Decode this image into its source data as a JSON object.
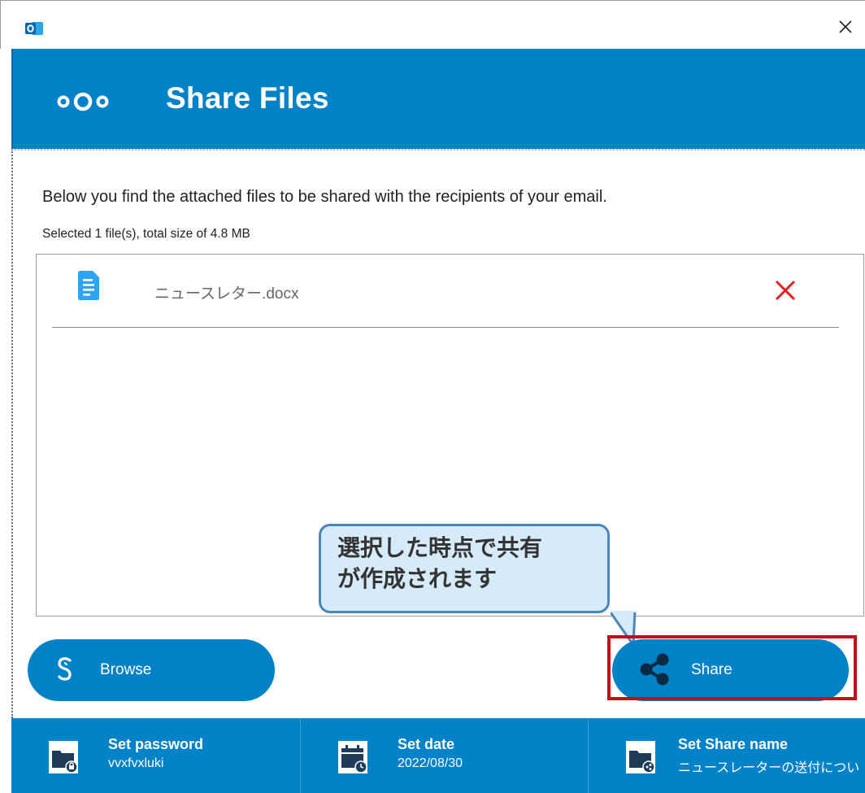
{
  "window": {
    "app_icon": "outlook-icon",
    "close_glyph": "✕"
  },
  "header": {
    "logo": "nextcloud-logo",
    "title": "Share Files"
  },
  "content": {
    "description": "Below you find the attached files to be shared with the recipients of your email.",
    "summary": "Selected 1 file(s), total size of 4.8 MB",
    "files": [
      {
        "name": "ニュースレター.docx",
        "icon": "document-icon",
        "remove_icon": "close-x-icon"
      }
    ]
  },
  "callout": {
    "line1": "選択した時点で共有",
    "line2": "が作成されます"
  },
  "buttons": {
    "browse_label": "Browse",
    "browse_icon": "nextcloud-s-icon",
    "share_label": "Share",
    "share_icon": "share-nodes-icon"
  },
  "settings": [
    {
      "title": "Set password",
      "value": "vvxfvxluki",
      "icon": "folder-lock-icon"
    },
    {
      "title": "Set date",
      "value": "2022/08/30",
      "icon": "calendar-clock-icon"
    },
    {
      "title": "Set Share name",
      "value": "ニュースレーターの送付につい",
      "icon": "folder-share-icon"
    }
  ],
  "colors": {
    "brand_blue": "#0082c9",
    "remove_red": "#e02020",
    "highlight_red": "#c0111a",
    "callout_fill": "#d6ebfa",
    "callout_border": "#4a86b9"
  }
}
